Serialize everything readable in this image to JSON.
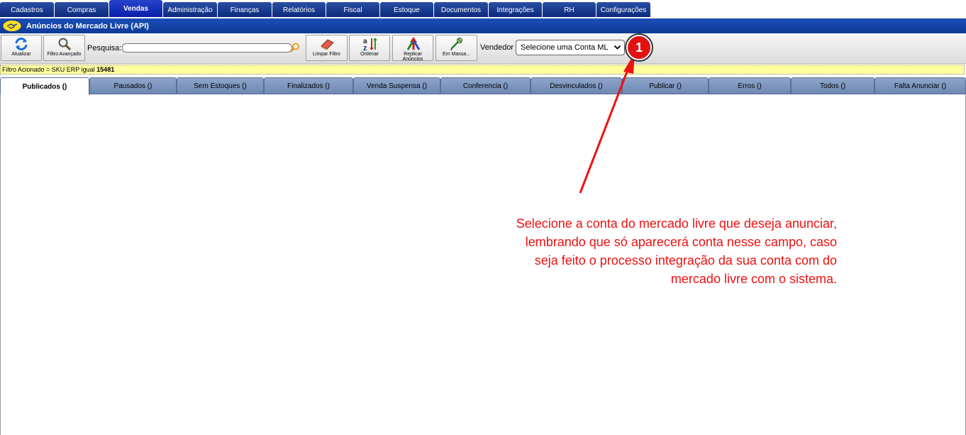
{
  "top_menu": [
    {
      "label": "Cadastros",
      "active": false
    },
    {
      "label": "Compras",
      "active": false
    },
    {
      "label": "Vendas",
      "active": true
    },
    {
      "label": "Administração",
      "active": false
    },
    {
      "label": "Finanças",
      "active": false
    },
    {
      "label": "Relatórios",
      "active": false
    },
    {
      "label": "Fiscal",
      "active": false
    },
    {
      "label": "Estoque",
      "active": false
    },
    {
      "label": "Documentos",
      "active": false
    },
    {
      "label": "Integrações",
      "active": false
    },
    {
      "label": "RH",
      "active": false
    },
    {
      "label": "Configurações",
      "active": false
    }
  ],
  "title": "Anúncios do Mercado Livre (API)",
  "toolbar": {
    "atualizar": "Atualizar",
    "filtro_avancado": "Filtro Avançado",
    "pesquisa_label": "Pesquisa:",
    "pesquisa_value": "",
    "limpar_filtro": "Limpar Filtro",
    "ordenar": "Ordenar",
    "replicar": "Replicar Anúncios",
    "em_massa": "Em Massa...",
    "vendedor_label": "Vendedor",
    "vendedor_selected": "Selecione uma Conta ML"
  },
  "filter": {
    "text": "Filtro Acionado = SKU ERP igual",
    "value": "15481"
  },
  "tabs": [
    {
      "label": "Publicados ()",
      "active": true
    },
    {
      "label": "Pausados ()",
      "active": false
    },
    {
      "label": "Sem Estoques ()",
      "active": false
    },
    {
      "label": "Finalizados ()",
      "active": false
    },
    {
      "label": "Venda Suspensa ()",
      "active": false
    },
    {
      "label": "Conferencia ()",
      "active": false
    },
    {
      "label": "Desvinculados ()",
      "active": false
    },
    {
      "label": "Publicar ()",
      "active": false
    },
    {
      "label": "Erros ()",
      "active": false
    },
    {
      "label": "Todos ()",
      "active": false
    },
    {
      "label": "Falta Anunciar ()",
      "active": false
    }
  ],
  "annotation": {
    "number": "1",
    "lines": [
      "Selecione a conta do mercado livre que deseja anunciar,",
      "lembrando que só aparecerá conta nesse campo, caso",
      "seja feito o processo integração da sua conta com do",
      "mercado livre com o sistema."
    ],
    "color": "#ee1111"
  },
  "icons": [
    "refresh-icon",
    "magnifier-filter-icon",
    "search-icon",
    "eraser-icon",
    "sort-az-icon",
    "replicate-arrows-icon",
    "bulk-edit-icon",
    "chevron-down-icon",
    "handshake-logo-icon"
  ]
}
